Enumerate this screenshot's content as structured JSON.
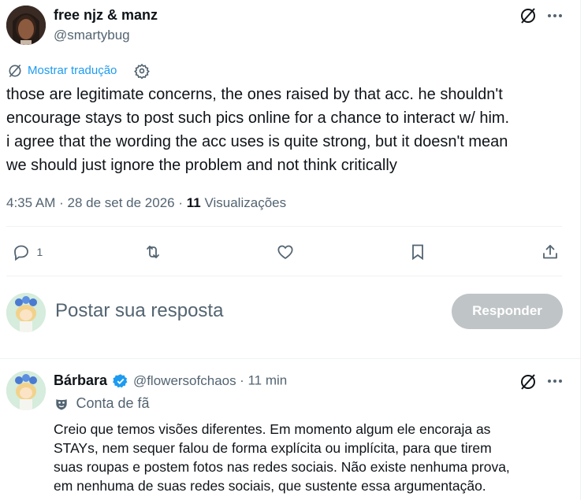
{
  "tweet": {
    "author_name": "free njz & manz",
    "author_handle": "@smartybug",
    "translate_label": "Mostrar tradução",
    "text": "those are legitimate concerns, the ones raised by that acc. he shouldn't\nencourage stays to post such pics online for a chance to interact w/ him.\ni agree that the wording the acc uses is quite strong, but it doesn't mean\nwe should just ignore the problem and not think critically",
    "time": "4:35 AM",
    "date": "28 de set de 2026",
    "views_count": "11",
    "views_label": "Visualizações",
    "reply_count": "1"
  },
  "composer": {
    "placeholder": "Postar sua resposta",
    "button_label": "Responder"
  },
  "reply": {
    "author_name": "Bárbara",
    "author_handle": "@flowersofchaos",
    "time": "11 min",
    "badge_label": "Conta de fã",
    "text": "Creio que temos visões diferentes. Em momento algum ele encoraja as\nSTAYs, nem sequer falou de forma explícita ou implícita, para que tirem\nsuas roupas e postem fotos nas redes sociais. Não existe nenhuma prova,\nem nenhuma de suas redes sociais, que sustente essa argumentação."
  },
  "colors": {
    "accent": "#1d9bf0",
    "muted": "#536471",
    "verified": "#1d9bf0",
    "button_disabled": "#bfc4c7"
  }
}
